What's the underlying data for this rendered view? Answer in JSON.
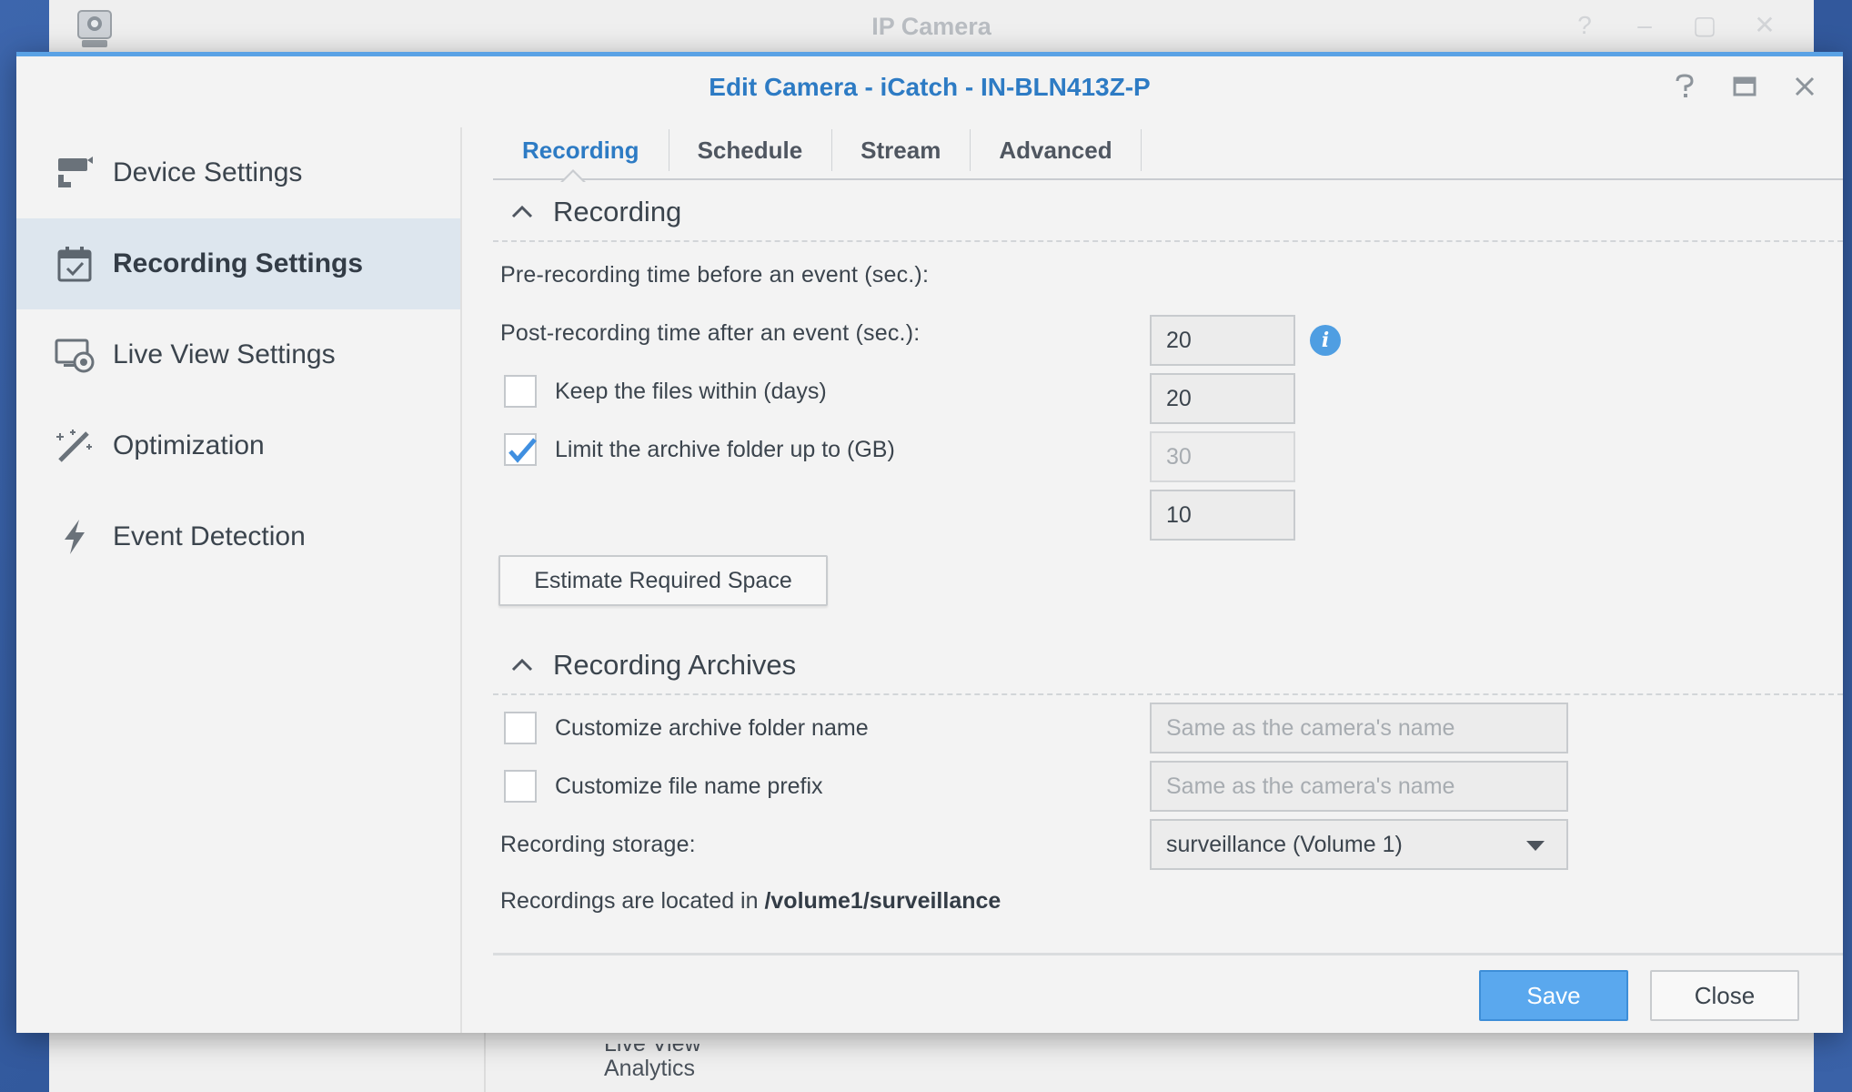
{
  "background_window": {
    "title": "IP Camera",
    "app_icon": "ip-camera-icon",
    "partial_menu": {
      "line1": "Live View",
      "line2": "Analytics"
    }
  },
  "dialog": {
    "title": "Edit Camera - iCatch - IN-BLN413Z-P",
    "controls": {
      "help": "help-icon",
      "maximize": "maximize-icon",
      "close": "close-icon"
    },
    "accent_color": "#2d7bc4"
  },
  "sidebar": {
    "items": [
      {
        "label": "Device Settings",
        "icon": "camera-device-icon",
        "active": false
      },
      {
        "label": "Recording Settings",
        "icon": "calendar-check-icon",
        "active": true
      },
      {
        "label": "Live View Settings",
        "icon": "monitor-camera-icon",
        "active": false
      },
      {
        "label": "Optimization",
        "icon": "magic-wand-icon",
        "active": false
      },
      {
        "label": "Event Detection",
        "icon": "lightning-icon",
        "active": false
      }
    ]
  },
  "tabs": [
    {
      "label": "Recording",
      "active": true
    },
    {
      "label": "Schedule",
      "active": false
    },
    {
      "label": "Stream",
      "active": false
    },
    {
      "label": "Advanced",
      "active": false
    }
  ],
  "recording": {
    "section_title": "Recording",
    "pre_recording": {
      "label": "Pre-recording time before an event (sec.):",
      "value": "20"
    },
    "post_recording": {
      "label": "Post-recording time after an event (sec.):",
      "value": "20"
    },
    "keep_files": {
      "label": "Keep the files within (days)",
      "checked": false,
      "value": "30"
    },
    "limit_archive": {
      "label": "Limit the archive folder up to (GB)",
      "checked": true,
      "value": "10"
    },
    "estimate_button": "Estimate Required Space"
  },
  "archives": {
    "section_title": "Recording Archives",
    "custom_folder": {
      "label": "Customize archive folder name",
      "checked": false,
      "placeholder": "Same as the camera's name"
    },
    "custom_prefix": {
      "label": "Customize file name prefix",
      "checked": false,
      "placeholder": "Same as the camera's name"
    },
    "storage": {
      "label": "Recording storage:",
      "value": "surveillance (Volume 1)"
    },
    "location": {
      "prefix": "Recordings are located in",
      "path": "/volume1/surveillance"
    }
  },
  "footer": {
    "save_label": "Save",
    "close_label": "Close",
    "save_color": "#5aa8ee"
  }
}
